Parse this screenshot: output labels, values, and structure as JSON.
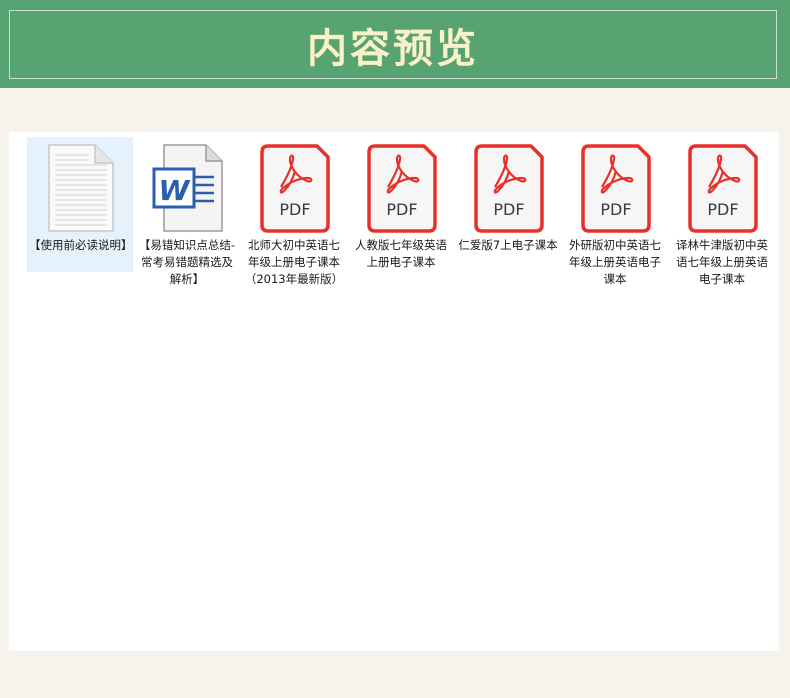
{
  "banner": {
    "title": "内容预览"
  },
  "files": [
    {
      "name": "【使用前必读说明】",
      "type": "text",
      "icon": "text-document-icon",
      "selected": true
    },
    {
      "name": "【易错知识点总结-常考易错题精选及解析】",
      "type": "word",
      "icon": "word-document-icon",
      "selected": false
    },
    {
      "name": "北师大初中英语七年级上册电子课本（2013年最新版）",
      "type": "pdf",
      "icon": "pdf-icon",
      "selected": false
    },
    {
      "name": "人教版七年级英语上册电子课本",
      "type": "pdf",
      "icon": "pdf-icon",
      "selected": false
    },
    {
      "name": "仁爱版7上电子课本",
      "type": "pdf",
      "icon": "pdf-icon",
      "selected": false
    },
    {
      "name": "外研版初中英语七年级上册英语电子课本",
      "type": "pdf",
      "icon": "pdf-icon",
      "selected": false
    },
    {
      "name": "译林牛津版初中英语七年级上册英语电子课本",
      "type": "pdf",
      "icon": "pdf-icon",
      "selected": false
    }
  ],
  "pdf_badge": "PDF",
  "word_letter": "W",
  "colors": {
    "banner": "#58a372",
    "title": "#fbf1c8",
    "pdf": "#e8302b",
    "word": "#2a5faf",
    "selection": "#e5f1fb"
  }
}
